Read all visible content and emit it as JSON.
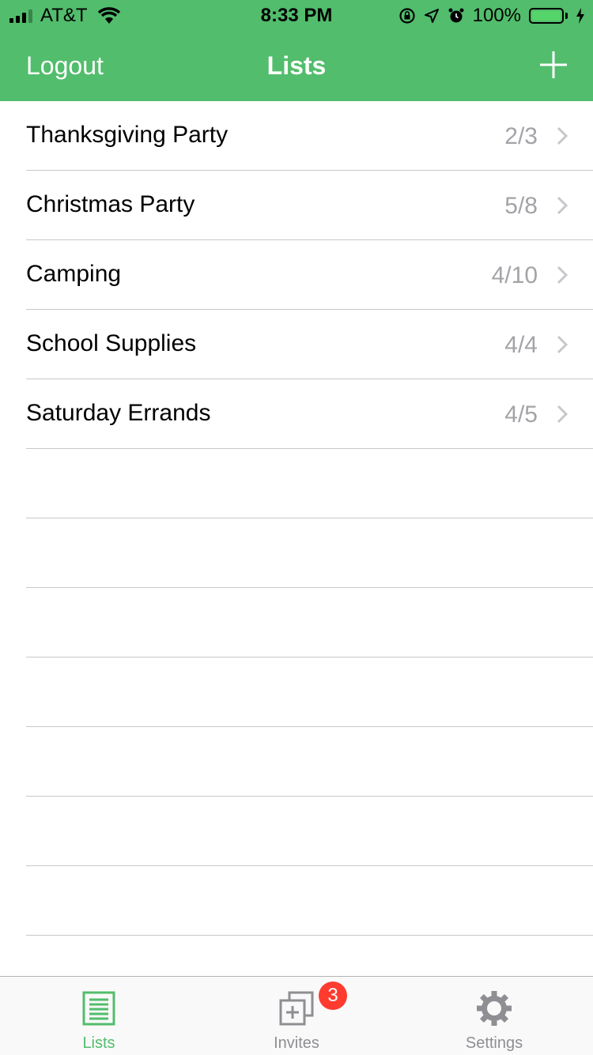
{
  "status_bar": {
    "carrier": "AT&T",
    "time": "8:33 PM",
    "battery_percent": "100%",
    "battery_level": 1.0,
    "icons": [
      "signal-icon",
      "wifi-icon",
      "rotation-lock-icon",
      "location-icon",
      "alarm-icon",
      "battery-icon",
      "charging-icon"
    ]
  },
  "nav": {
    "left_label": "Logout",
    "title": "Lists",
    "right_icon": "plus-icon"
  },
  "lists": [
    {
      "title": "Thanksgiving Party",
      "count": "2/3"
    },
    {
      "title": "Christmas Party",
      "count": "5/8"
    },
    {
      "title": "Camping",
      "count": "4/10"
    },
    {
      "title": "School Supplies",
      "count": "4/4"
    },
    {
      "title": "Saturday Errands",
      "count": "4/5"
    }
  ],
  "tabs": [
    {
      "label": "Lists",
      "icon": "list-icon",
      "active": true
    },
    {
      "label": "Invites",
      "icon": "invites-icon",
      "badge": "3"
    },
    {
      "label": "Settings",
      "icon": "gear-icon"
    }
  ],
  "colors": {
    "accent": "#52bd6c",
    "badge": "#ff3b30",
    "secondary_text": "#a3a3a8",
    "inactive_tab": "#8e8e93"
  }
}
